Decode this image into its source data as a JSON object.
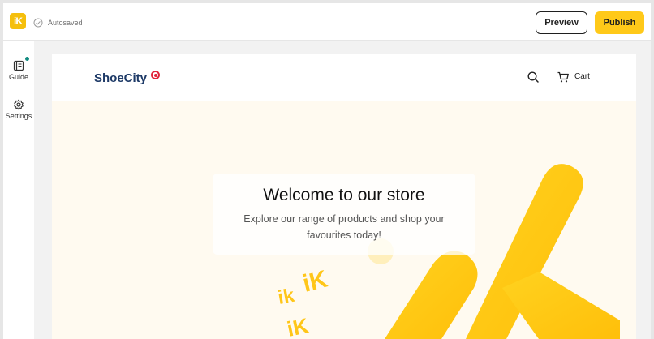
{
  "topbar": {
    "logo_text": "iK",
    "autosave_status": "Autosaved",
    "autosave_icon": "check-circle-icon",
    "preview_label": "Preview",
    "publish_label": "Publish",
    "accent_color": "#ffc919"
  },
  "rail": {
    "items": [
      {
        "label": "Guide",
        "icon": "book-icon",
        "has_notification": true
      },
      {
        "label": "Settings",
        "icon": "gear-icon"
      }
    ],
    "notification_color": "#128b80"
  },
  "store": {
    "brand_name": "ShoeCity",
    "brand_color": "#1e3a67",
    "search_icon": "search-icon",
    "cart_icon": "cart-icon",
    "cart_label": "Cart"
  },
  "hero": {
    "title": "Welcome to our store",
    "subtitle": "Explore our range of products and shop your favourites today!",
    "background": "#fffaf0",
    "art_color": "#ffc919"
  }
}
